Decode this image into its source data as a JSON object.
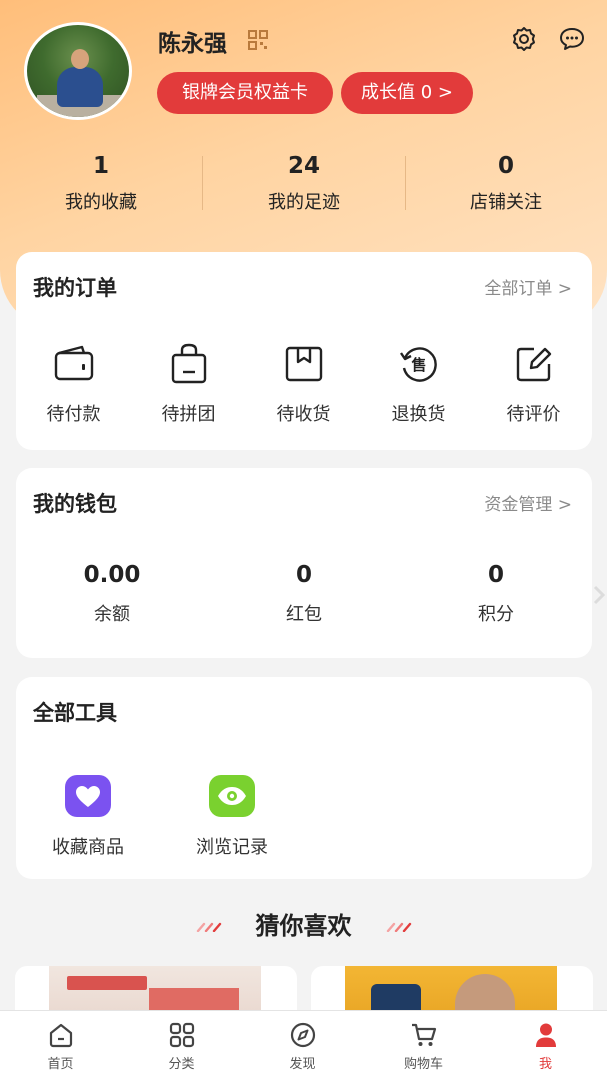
{
  "profile": {
    "name": "陈永强",
    "member_card": "银牌会员权益卡",
    "growth": "成长值 0 >"
  },
  "stats": [
    {
      "value": "1",
      "label": "我的收藏"
    },
    {
      "value": "24",
      "label": "我的足迹"
    },
    {
      "value": "0",
      "label": "店铺关注"
    }
  ],
  "orders": {
    "title": "我的订单",
    "link": "全部订单 >",
    "items": [
      {
        "label": "待付款",
        "icon": "wallet-icon"
      },
      {
        "label": "待拼团",
        "icon": "bag-icon"
      },
      {
        "label": "待收货",
        "icon": "package-icon"
      },
      {
        "label": "退换货",
        "icon": "after-sale-icon",
        "glyph": "售"
      },
      {
        "label": "待评价",
        "icon": "edit-review-icon"
      }
    ]
  },
  "wallet": {
    "title": "我的钱包",
    "link": "资金管理 >",
    "items": [
      {
        "value": "0.00",
        "label": "余额"
      },
      {
        "value": "0",
        "label": "红包"
      },
      {
        "value": "0",
        "label": "积分"
      }
    ]
  },
  "tools": {
    "title": "全部工具",
    "items": [
      {
        "label": "收藏商品",
        "icon": "heart-icon",
        "color": "#7b52f0"
      },
      {
        "label": "浏览记录",
        "icon": "eye-icon",
        "color": "#7ad12f"
      }
    ]
  },
  "guess": {
    "title": "猜你喜欢"
  },
  "tabbar": [
    {
      "label": "首页",
      "icon": "home-icon"
    },
    {
      "label": "分类",
      "icon": "category-icon"
    },
    {
      "label": "发现",
      "icon": "compass-icon"
    },
    {
      "label": "购物车",
      "icon": "cart-icon"
    },
    {
      "label": "我",
      "icon": "profile-icon",
      "active": true
    }
  ],
  "colors": {
    "accent": "#e23b3b",
    "hero_start": "#ffbe7a",
    "hero_end": "#ffe3c4"
  }
}
